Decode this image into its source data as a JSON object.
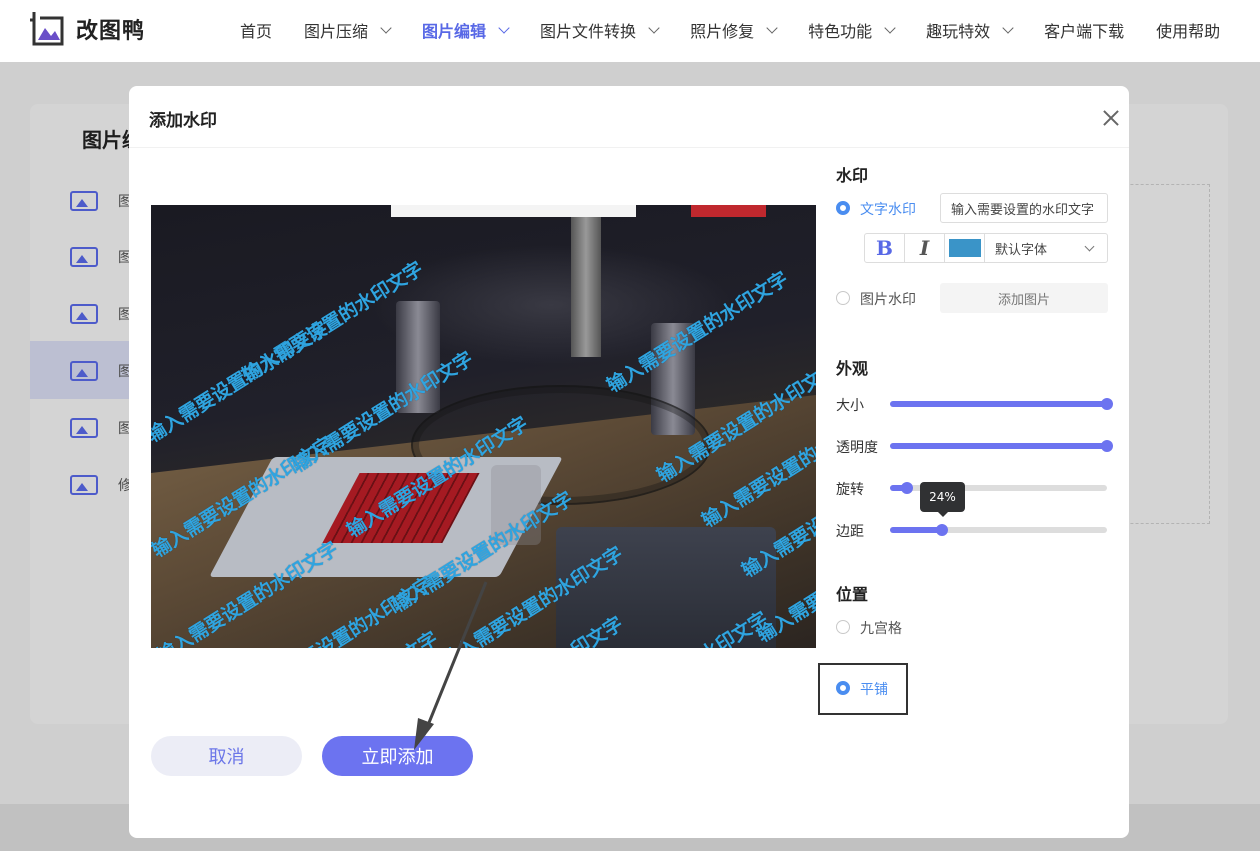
{
  "app": {
    "logo_text": "改图鸭"
  },
  "nav": {
    "items": [
      {
        "label": "首页",
        "dropdown": false,
        "active": false
      },
      {
        "label": "图片压缩",
        "dropdown": true,
        "active": false
      },
      {
        "label": "图片编辑",
        "dropdown": true,
        "active": true
      },
      {
        "label": "图片文件转换",
        "dropdown": true,
        "active": false
      },
      {
        "label": "照片修复",
        "dropdown": true,
        "active": false
      },
      {
        "label": "特色功能",
        "dropdown": true,
        "active": false
      },
      {
        "label": "趣玩特效",
        "dropdown": true,
        "active": false
      },
      {
        "label": "客户端下载",
        "dropdown": false,
        "active": false
      },
      {
        "label": "使用帮助",
        "dropdown": false,
        "active": false
      }
    ]
  },
  "background_page": {
    "title": "图片编",
    "sidebar_items": [
      "图",
      "图",
      "图",
      "图",
      "图",
      "修"
    ]
  },
  "modal": {
    "title": "添加水印",
    "watermark_text_overlay": "输入需要设置的水印文字",
    "cancel_label": "取消",
    "add_label": "立即添加",
    "watermark_section": {
      "title": "水印",
      "text_option": "文字水印",
      "text_input_value": "输入需要设置的水印文字",
      "bold_label": "B",
      "italic_label": "I",
      "color": "#3a94c8",
      "font_select": "默认字体",
      "image_option": "图片水印",
      "add_image_label": "添加图片",
      "selected": "text"
    },
    "appearance_section": {
      "title": "外观",
      "sliders": [
        {
          "label": "大小",
          "value": 100
        },
        {
          "label": "透明度",
          "value": 100
        },
        {
          "label": "旋转",
          "value": 8
        },
        {
          "label": "边距",
          "value": 24
        }
      ],
      "tooltip": "24%"
    },
    "position_section": {
      "title": "位置",
      "options": [
        "九宫格",
        "平铺"
      ],
      "selected": "平铺"
    }
  },
  "colors": {
    "accent": "#6c73f0",
    "active_nav": "#5868e6",
    "radio_on": "#4a8df0"
  }
}
